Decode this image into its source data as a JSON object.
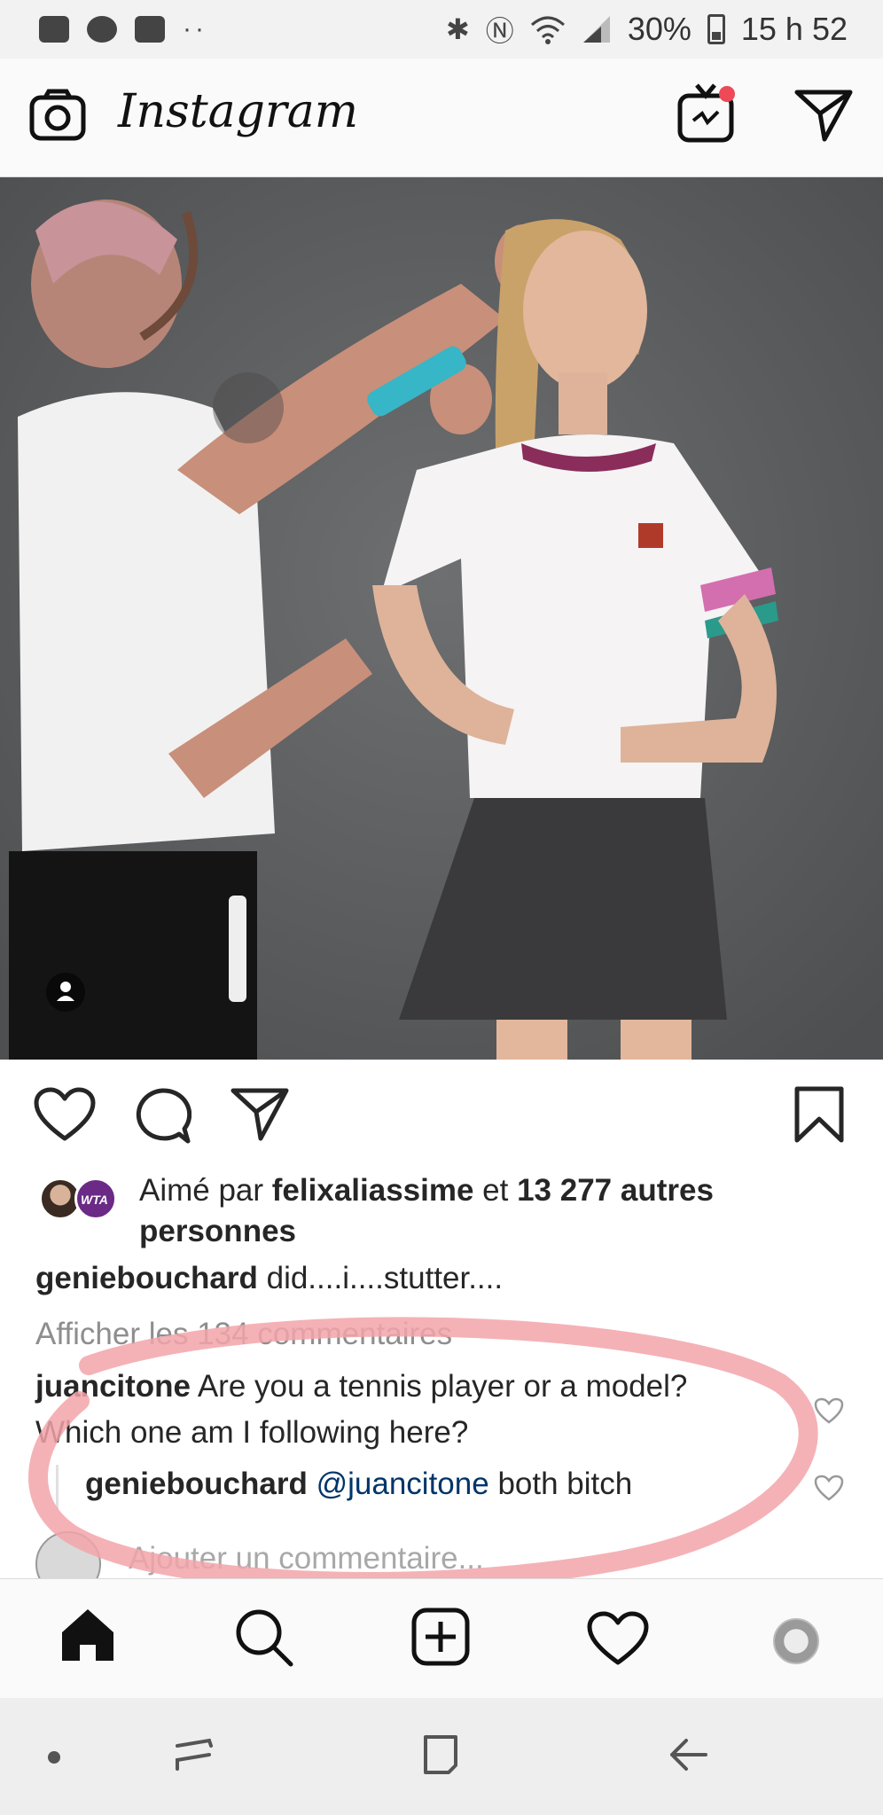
{
  "status_bar": {
    "time": "15 h 52",
    "battery": "30%",
    "dots": "··",
    "icons": [
      "activity-app-icon",
      "messenger-icon",
      "outlook-icon",
      "bluetooth-icon",
      "nfc-icon",
      "wifi-icon",
      "signal-icon",
      "battery-icon"
    ]
  },
  "header": {
    "logo": "Instagram",
    "icons": [
      "camera-icon",
      "igtv-icon",
      "direct-message-icon"
    ],
    "notification_color": "#ed4956"
  },
  "post": {
    "liked_by": {
      "prefix": "Aimé par ",
      "user": "felixaliassime",
      "connector": " et ",
      "count": "13 277 autres personnes",
      "badge_text": "WTA"
    },
    "caption": {
      "user": "geniebouchard",
      "text": " did....i....stutter...."
    },
    "view_all_comments": "Afficher les 134 commentaires",
    "comment": {
      "user": "juancitone",
      "text": " Are you a tennis player or a model? Which one am I following here?"
    },
    "reply": {
      "user": "geniebouchard",
      "mention": "@juancitone",
      "text": " both bitch"
    },
    "add_comment_placeholder": "Ajouter un commentaire..."
  },
  "annotation": {
    "color": "#f2a5aa"
  },
  "bottom_nav": [
    "home-icon",
    "search-icon",
    "new-post-icon",
    "activity-heart-icon",
    "profile-avatar"
  ],
  "system_nav": [
    "dot-icon",
    "recents-icon",
    "home-square-icon",
    "back-icon"
  ]
}
